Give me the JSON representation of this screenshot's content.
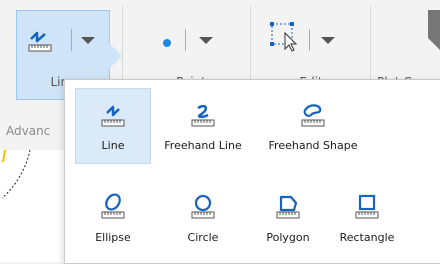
{
  "ribbon": {
    "tools": [
      {
        "label": "Line",
        "icon": "line-tool-icon"
      },
      {
        "label": "Point",
        "icon": "point-tool-icon"
      },
      {
        "label": "Edit",
        "icon": "edit-vertices-icon"
      },
      {
        "label": "Plot Co",
        "icon": "plot-icon"
      }
    ],
    "group_label": "Advanc"
  },
  "popup": {
    "items": [
      {
        "label": "Line",
        "icon": "line-icon",
        "selected": true
      },
      {
        "label": "Freehand Line",
        "icon": "freehand-line-icon"
      },
      {
        "label": "Freehand Shape",
        "icon": "freehand-shape-icon"
      },
      {
        "label": "Ellipse",
        "icon": "ellipse-icon"
      },
      {
        "label": "Circle",
        "icon": "circle-icon"
      },
      {
        "label": "Polygon",
        "icon": "polygon-icon"
      },
      {
        "label": "Rectangle",
        "icon": "rectangle-icon"
      }
    ]
  },
  "colors": {
    "accent": "#1e6fd0",
    "selected_bg": "#cfe4f7",
    "icon_blue": "#1565c0"
  }
}
